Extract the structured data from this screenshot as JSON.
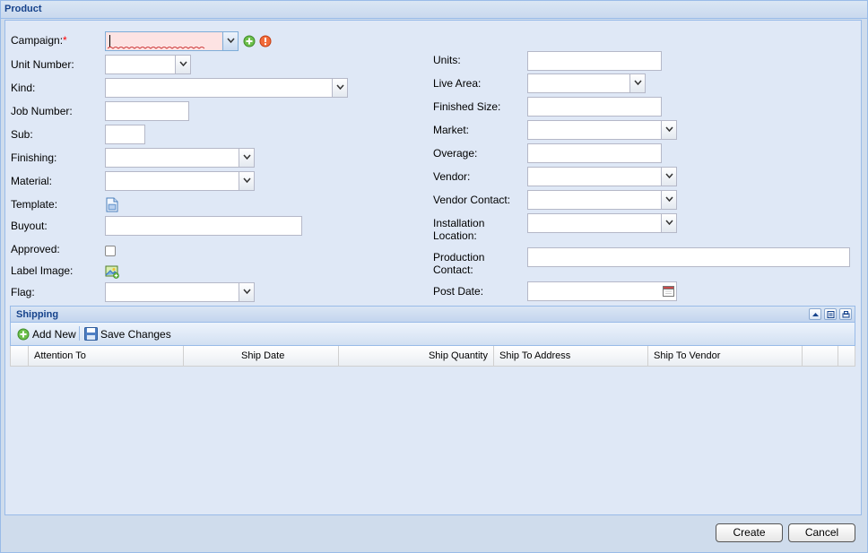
{
  "window": {
    "title": "Product"
  },
  "form": {
    "left": {
      "campaign_label": "Campaign:",
      "campaign_required": "*",
      "campaign_value": "",
      "unit_number_label": "Unit Number:",
      "kind_label": "Kind:",
      "job_number_label": "Job Number:",
      "sub_label": "Sub:",
      "finishing_label": "Finishing:",
      "material_label": "Material:",
      "template_label": "Template:",
      "buyout_label": "Buyout:",
      "approved_label": "Approved:",
      "label_image_label": "Label Image:",
      "flag_label": "Flag:"
    },
    "right": {
      "units_label": "Units:",
      "live_area_label": "Live Area:",
      "finished_size_label": "Finished Size:",
      "market_label": "Market:",
      "overage_label": "Overage:",
      "vendor_label": "Vendor:",
      "vendor_contact_label": "Vendor Contact:",
      "installation_location_label_1": "Installation",
      "installation_location_label_2": "Location:",
      "production_contact_label_1": "Production",
      "production_contact_label_2": "Contact:",
      "post_date_label": "Post Date:"
    }
  },
  "shipping": {
    "title": "Shipping",
    "add_new_label": "Add New",
    "save_changes_label": "Save Changes",
    "columns": [
      "Attention To",
      "Ship Date",
      "Ship Quantity",
      "Ship To Address",
      "Ship To Vendor"
    ]
  },
  "footer": {
    "create_label": "Create",
    "cancel_label": "Cancel"
  },
  "colors": {
    "header_text": "#15428b",
    "panel_bg": "#dfe8f6",
    "border": "#99bbe8",
    "required": "#ff0000"
  }
}
